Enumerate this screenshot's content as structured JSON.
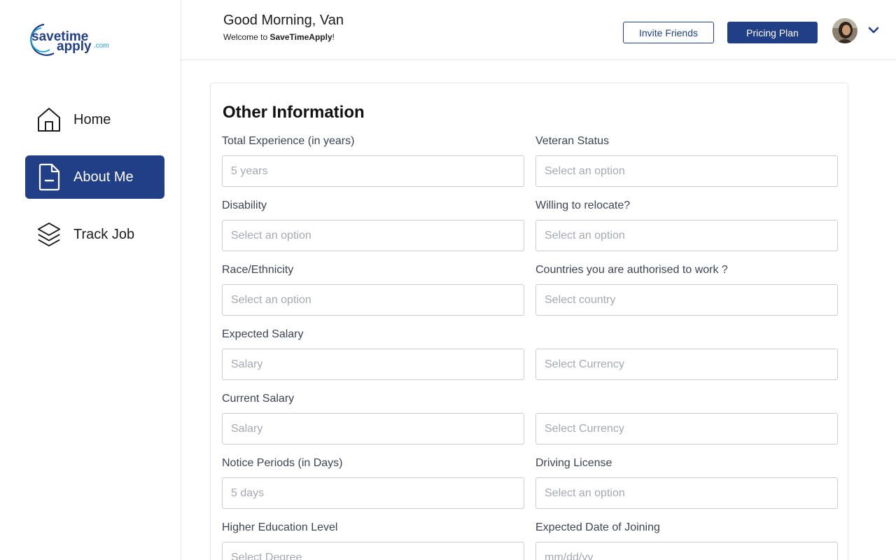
{
  "brand": {
    "logo_line1": "savetime",
    "logo_line2": "apply",
    "logo_suffix": ".com"
  },
  "sidebar": {
    "items": [
      {
        "label": "Home",
        "icon": "home-icon",
        "active": false
      },
      {
        "label": "About Me",
        "icon": "document-icon",
        "active": true
      },
      {
        "label": "Track Job",
        "icon": "layers-icon",
        "active": false
      }
    ]
  },
  "header": {
    "greeting": "Good Morning, Van",
    "welcome_prefix": "Welcome to ",
    "welcome_brand": "SaveTimeApply",
    "welcome_suffix": "!",
    "invite_label": "Invite Friends",
    "pricing_label": "Pricing Plan"
  },
  "form": {
    "title": "Other Information",
    "fields": {
      "total_experience": {
        "label": "Total Experience (in years)",
        "placeholder": "5 years"
      },
      "veteran_status": {
        "label": "Veteran Status",
        "placeholder": "Select an option"
      },
      "disability": {
        "label": "Disability",
        "placeholder": "Select an option"
      },
      "relocate": {
        "label": "Willing to relocate?",
        "placeholder": "Select an option"
      },
      "race": {
        "label": "Race/Ethnicity",
        "placeholder": "Select an option"
      },
      "countries": {
        "label": "Countries you are authorised to work ?",
        "placeholder": "Select country"
      },
      "expected_salary": {
        "label": "Expected Salary",
        "placeholder": "Salary"
      },
      "expected_currency": {
        "placeholder": "Select Currency"
      },
      "current_salary": {
        "label": "Current Salary",
        "placeholder": "Salary"
      },
      "current_currency": {
        "placeholder": "Select Currency"
      },
      "notice_period": {
        "label": "Notice Periods (in Days)",
        "placeholder": "5 days"
      },
      "driving_license": {
        "label": "Driving License",
        "placeholder": "Select an option"
      },
      "education": {
        "label": "Higher Education Level",
        "placeholder": "Select Degree"
      },
      "joining_date": {
        "label": "Expected Date of Joining",
        "placeholder": "mm/dd/yy"
      }
    }
  },
  "colors": {
    "primary": "#213f87",
    "logo_accent": "#1aa3d6"
  }
}
